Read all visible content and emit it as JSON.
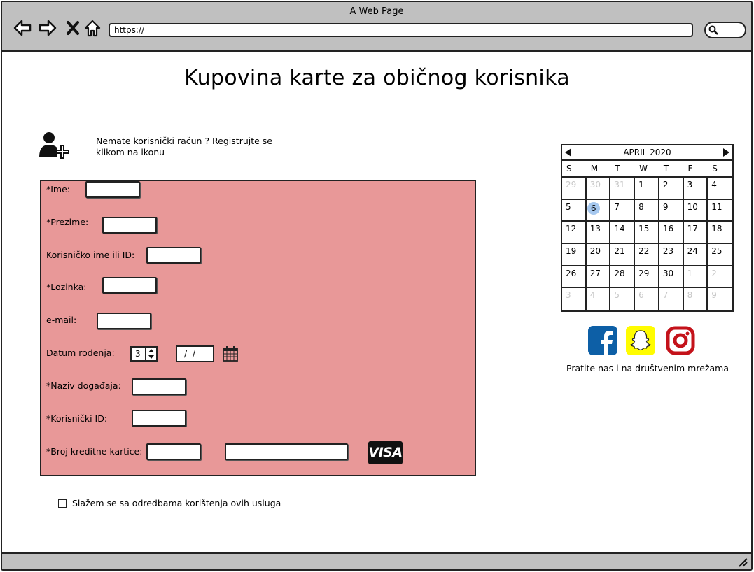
{
  "window": {
    "title": "A Web Page",
    "url": "https://"
  },
  "page": {
    "title": "Kupovina karte za običnog korisnika",
    "register_hint": "Nemate korisnički račun ? Registrujte se klikom na ikonu"
  },
  "form": {
    "fields": [
      {
        "label": "*Ime:",
        "value": ""
      },
      {
        "label": "*Prezime:",
        "value": ""
      },
      {
        "label": "Korisničko ime ili ID:",
        "value": ""
      },
      {
        "label": "*Lozinka:",
        "value": ""
      },
      {
        "label": "e-mail:",
        "value": ""
      },
      {
        "label": "Datum rođenja:",
        "stepper_value": "3",
        "date_value": "/ /"
      },
      {
        "label": "*Naziv događaja:",
        "value": ""
      },
      {
        "label": "*Korisnički ID:",
        "value": ""
      },
      {
        "label": "*Broj kreditne kartice:",
        "value": "",
        "value2": "",
        "card_brand": "VISA"
      }
    ],
    "agree_label": "Slažem se sa odredbama korištenja ovih usluga",
    "agree_checked": false,
    "panel_color": "#e89898"
  },
  "calendar": {
    "month_label": "APRIL 2020",
    "weekdays": [
      "S",
      "M",
      "T",
      "W",
      "T",
      "F",
      "S"
    ],
    "days": [
      {
        "d": "29",
        "m": true
      },
      {
        "d": "30",
        "m": true
      },
      {
        "d": "31",
        "m": true
      },
      {
        "d": "1"
      },
      {
        "d": "2"
      },
      {
        "d": "3"
      },
      {
        "d": "4"
      },
      {
        "d": "5"
      },
      {
        "d": "6",
        "sel": true
      },
      {
        "d": "7"
      },
      {
        "d": "8"
      },
      {
        "d": "9"
      },
      {
        "d": "10"
      },
      {
        "d": "11"
      },
      {
        "d": "12"
      },
      {
        "d": "13"
      },
      {
        "d": "14"
      },
      {
        "d": "15"
      },
      {
        "d": "16"
      },
      {
        "d": "17"
      },
      {
        "d": "18"
      },
      {
        "d": "19"
      },
      {
        "d": "20"
      },
      {
        "d": "21"
      },
      {
        "d": "22"
      },
      {
        "d": "23"
      },
      {
        "d": "24"
      },
      {
        "d": "25"
      },
      {
        "d": "26"
      },
      {
        "d": "27"
      },
      {
        "d": "28"
      },
      {
        "d": "29"
      },
      {
        "d": "30"
      },
      {
        "d": "1",
        "m": true
      },
      {
        "d": "2",
        "m": true
      },
      {
        "d": "3",
        "m": true
      },
      {
        "d": "4",
        "m": true
      },
      {
        "d": "5",
        "m": true
      },
      {
        "d": "6",
        "m": true
      },
      {
        "d": "7",
        "m": true
      },
      {
        "d": "8",
        "m": true
      },
      {
        "d": "9",
        "m": true
      }
    ],
    "selected_color": "#a6c8ef"
  },
  "social": {
    "caption": "Pratite nas i na društvenim mrežama",
    "icons": [
      {
        "name": "facebook-icon",
        "color": "#0d5fa6"
      },
      {
        "name": "snapchat-icon",
        "color": "#fffc00"
      },
      {
        "name": "instagram-icon",
        "color": "#c4121a"
      }
    ]
  }
}
